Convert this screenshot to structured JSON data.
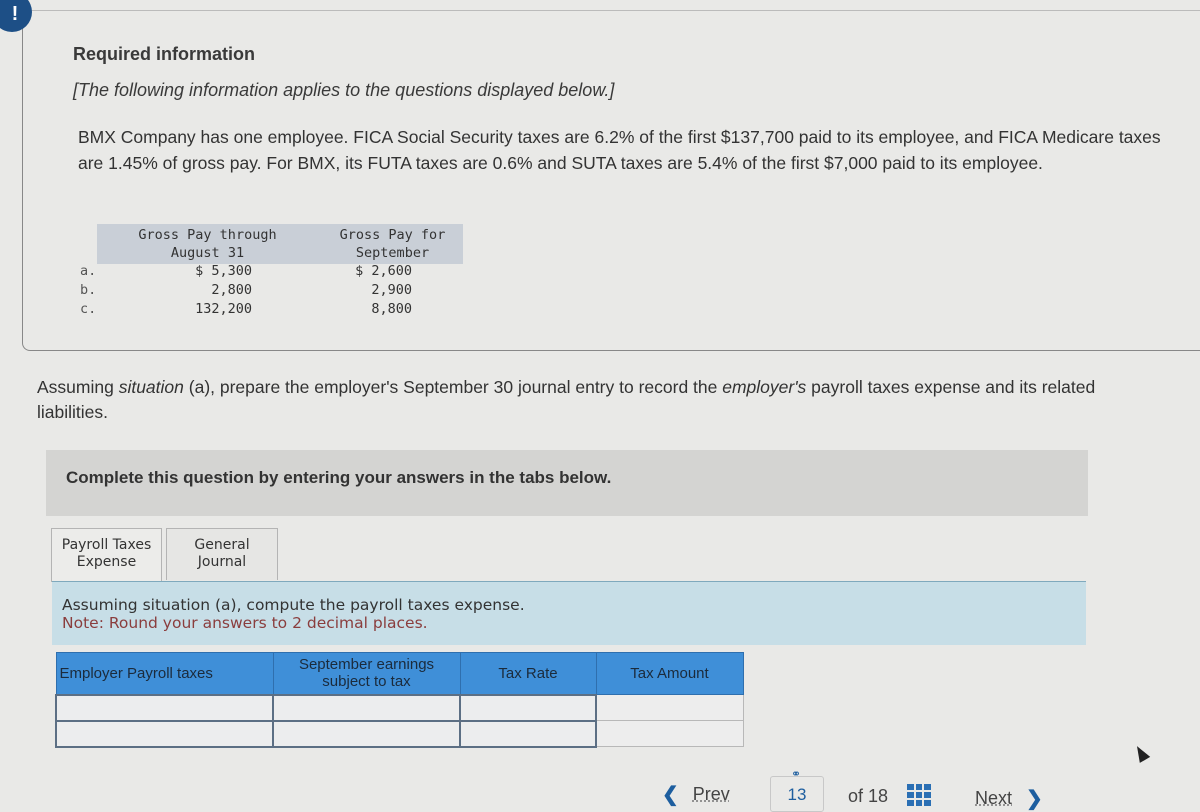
{
  "alert_icon": "!",
  "required_info": {
    "title": "Required information",
    "subtitle": "[The following information applies to the questions displayed below.]",
    "body": "BMX Company has one employee. FICA Social Security taxes are 6.2% of the first $137,700 paid to its employee, and FICA Medicare taxes are 1.45% of gross pay. For BMX, its FUTA taxes are 0.6% and SUTA taxes are 5.4% of the first $7,000 paid to its employee."
  },
  "gross_pay_table": {
    "col1_header_line1": "Gross Pay through",
    "col1_header_line2": "August 31",
    "col2_header_line1": "Gross Pay for",
    "col2_header_line2": "September",
    "rows": [
      {
        "label": "a.",
        "through_aug31": "$ 5,300",
        "september": "$ 2,600"
      },
      {
        "label": "b.",
        "through_aug31": "2,800",
        "september": "2,900"
      },
      {
        "label": "c.",
        "through_aug31": "132,200",
        "september": "8,800"
      }
    ]
  },
  "question": {
    "part1": "Assuming ",
    "italic1": "situation",
    "part2": " (a), prepare the employer's September 30 journal entry to record the ",
    "italic2": "employer's",
    "part3": " payroll taxes expense and its related liabilities."
  },
  "complete_banner": "Complete this question by entering your answers in the tabs below.",
  "tabs": [
    {
      "line1": "Payroll Taxes",
      "line2": "Expense",
      "active": true
    },
    {
      "line1": "General",
      "line2": "Journal",
      "active": false
    }
  ],
  "instructions": {
    "line1": "Assuming situation (a), compute the payroll taxes expense.",
    "note": "Note: Round your answers to 2 decimal places."
  },
  "tax_table": {
    "headers": [
      "Employer Payroll taxes",
      "September earnings subject to tax",
      "Tax Rate",
      "Tax Amount"
    ],
    "rows": [
      {
        "tax": "",
        "earnings": "",
        "rate": "",
        "amount": ""
      },
      {
        "tax": "",
        "earnings": "",
        "rate": "",
        "amount": ""
      }
    ]
  },
  "pager": {
    "prev_label": "Prev",
    "current_page": "13",
    "of_label": "of 18",
    "next_label": "Next",
    "link_icon": "link-icon",
    "grid_icon": "grid-icon"
  },
  "colors": {
    "accent_blue": "#1d5e9f",
    "table_header_blue": "#3f8fd8",
    "instruction_bg": "#c7dee7",
    "note_color": "#8a3d3d"
  }
}
